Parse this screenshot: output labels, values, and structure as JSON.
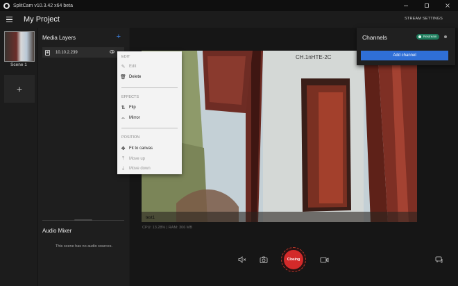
{
  "window": {
    "title": "SplitCam v10.3.42 x64 beta"
  },
  "header": {
    "project_title": "My Project",
    "stream_settings": "STREAM SETTINGS"
  },
  "scenes": {
    "items": [
      {
        "label": "Scene 1"
      }
    ],
    "add_icon": "plus-icon"
  },
  "layers": {
    "title": "Media Layers",
    "add_label": "+",
    "items": [
      {
        "name": "10.10.2.239",
        "icon": "camera-icon",
        "visibility_icon": "eye-icon"
      }
    ]
  },
  "mixer": {
    "title": "Audio Mixer",
    "empty_text": "This scene has no audio sources."
  },
  "canvas": {
    "stats": "CPU: 13.28% | RAM: 306 MB"
  },
  "controls": {
    "record_label": "Closing"
  },
  "channels": {
    "title": "Channels",
    "badge": "Restream",
    "add_button": "Add channel"
  },
  "context_menu": {
    "sections": [
      {
        "title": "EDIT",
        "items": [
          {
            "label": "Edit",
            "enabled": false
          },
          {
            "label": "Delete",
            "enabled": true
          }
        ]
      },
      {
        "title": "EFFECTS",
        "items": [
          {
            "label": "Flip",
            "enabled": true
          },
          {
            "label": "Mirror",
            "enabled": true
          }
        ]
      },
      {
        "title": "POSITION",
        "items": [
          {
            "label": "Fit to canvas",
            "enabled": true
          },
          {
            "label": "Move up",
            "enabled": false
          },
          {
            "label": "Move down",
            "enabled": false
          }
        ]
      }
    ]
  },
  "colors": {
    "accent": "#2f6fd6",
    "record": "#d32a2a",
    "badge": "#1f7a5c"
  }
}
